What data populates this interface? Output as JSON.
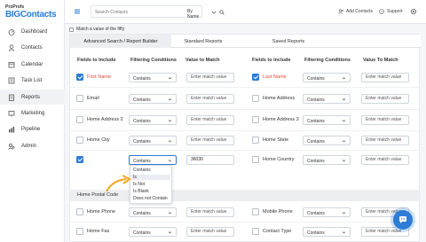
{
  "brand": {
    "top": "ProProfs",
    "name": "BIGContacts"
  },
  "sidebar": {
    "items": [
      {
        "label": "Dashboard",
        "icon": "dashboard-icon"
      },
      {
        "label": "Contacts",
        "icon": "contacts-icon"
      },
      {
        "label": "Calendar",
        "icon": "calendar-icon"
      },
      {
        "label": "Task List",
        "icon": "task-list-icon"
      },
      {
        "label": "Reports",
        "icon": "reports-icon",
        "active": true
      },
      {
        "label": "Marketing",
        "icon": "marketing-icon"
      },
      {
        "label": "Pipeline",
        "icon": "pipeline-icon"
      },
      {
        "label": "Admin",
        "icon": "admin-icon"
      }
    ]
  },
  "topbar": {
    "search_placeholder": "Search Contacts",
    "search_by": "By Name",
    "add_contacts": "Add Contacts",
    "support": "Support"
  },
  "main": {
    "match_label": "Match a value of the fifty",
    "tabs": [
      {
        "label": "Advanced Search / Report Builder",
        "active": true
      },
      {
        "label": "Standard Reports"
      },
      {
        "label": "Saved Reports"
      }
    ],
    "headers": {
      "fields": "Fields to Include",
      "filtering": "Filtering Conditions",
      "value": "Value to Match",
      "fields2": "Fields to Include",
      "filtering2": "Filtering Conditions",
      "value2": "Value To Match"
    },
    "left_rows": [
      {
        "label": "First Name",
        "checked": true,
        "red": true,
        "condition": "Contains",
        "value": "Enter match value"
      },
      {
        "label": "Email",
        "checked": false,
        "condition": "Contains",
        "value": "Enter match value"
      },
      {
        "label": "Home Address 2",
        "checked": false,
        "condition": "Contains",
        "value": "Enter match value"
      },
      {
        "label": "Home City",
        "checked": false,
        "condition": "Contains",
        "value": "Enter match value"
      },
      {
        "label": "",
        "checked": true,
        "condition": "Contains",
        "value": "36030"
      }
    ],
    "right_rows": [
      {
        "label": "Last Name",
        "checked": true,
        "red": true,
        "condition": "Contains",
        "value": "Enter match value"
      },
      {
        "label": "Home Address",
        "checked": false,
        "condition": "Contains",
        "value": "Enter match value"
      },
      {
        "label": "Home Address 3",
        "checked": false,
        "condition": "Contains",
        "value": "Enter match value"
      },
      {
        "label": "Home State",
        "checked": false,
        "condition": "Contains",
        "value": "Enter match value"
      },
      {
        "label": "Home Country",
        "checked": false,
        "condition": "Contains",
        "value": "Enter match value"
      }
    ],
    "dropdown_options": [
      "Contains",
      "Is",
      "Is Not",
      "Is Blank",
      "Does not Contain"
    ],
    "dropdown_highlight": "Is",
    "section_title": "Home Postal Code",
    "bottom_left": [
      {
        "label": "Home Phone",
        "condition": "Contains",
        "value": "Enter match value"
      },
      {
        "label": "Home Fax",
        "condition": "Contains",
        "value": "Enter match value"
      }
    ],
    "bottom_right": [
      {
        "label": "Mobile Phone",
        "condition": "Contains",
        "value": "Enter match value"
      },
      {
        "label": "Contact Type",
        "condition": "Contains",
        "value": "Enter match value"
      }
    ]
  },
  "colors": {
    "accent": "#2d7cd6",
    "required": "#e0493d",
    "arrow": "#f5a623"
  }
}
